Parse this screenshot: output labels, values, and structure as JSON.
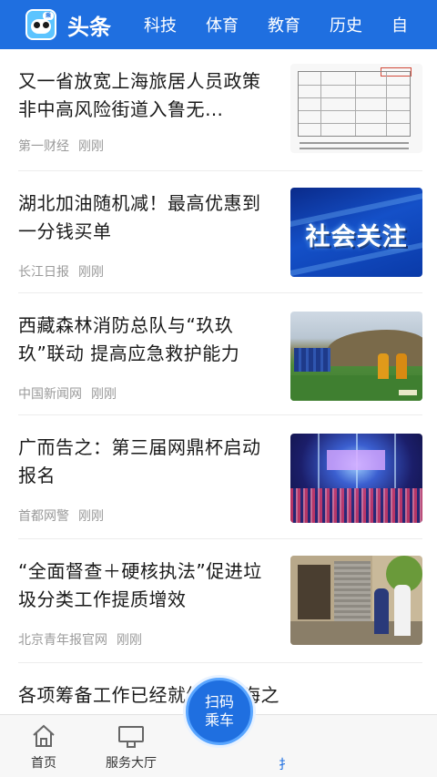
{
  "header": {
    "logo_icon": "panda-logo-icon",
    "tabs": [
      {
        "label": "头条",
        "active": true
      },
      {
        "label": "科技"
      },
      {
        "label": "体育"
      },
      {
        "label": "教育"
      },
      {
        "label": "历史"
      },
      {
        "label": "自"
      }
    ]
  },
  "feed": {
    "items": [
      {
        "title": "又一省放宽上海旅居人员政策 非中高风险街道入鲁无…",
        "source": "第一财经",
        "time": "刚刚",
        "thumb": "policy-table-image"
      },
      {
        "title": "湖北加油随机减！最高优惠到一分钱买单",
        "source": "长江日报",
        "time": "刚刚",
        "thumb": "social-attention-image",
        "thumb_text": "社会关注"
      },
      {
        "title": "西藏森林消防总队与“玖玖玖”联动 提高应急救护能力",
        "source": "中国新闻网",
        "time": "刚刚",
        "thumb": "firefighters-field-image"
      },
      {
        "title": "广而告之：第三届网鼎杯启动报名",
        "source": "首都网警",
        "time": "刚刚",
        "thumb": "stage-event-image"
      },
      {
        "title": "“全面督查＋硬核执法”促进垃圾分类工作提质增效",
        "source": "北京青年报官网",
        "time": "刚刚",
        "thumb": "inspection-doorway-image"
      },
      {
        "title": "各项筹备工作已经就绪！上海之策大…",
        "source": "",
        "time": ""
      }
    ]
  },
  "bottom_nav": {
    "items": [
      {
        "label": "首页",
        "icon": "home-icon"
      },
      {
        "label": "服务大厅",
        "icon": "monitor-icon"
      },
      {
        "label": "扌",
        "icon": "partial-icon"
      }
    ],
    "scan_button": {
      "line1": "扫码",
      "line2": "乘车"
    }
  },
  "colors": {
    "brand_blue": "#1f6fe0",
    "meta_gray": "#9a9a9a",
    "title_black": "#1a1a1a"
  }
}
